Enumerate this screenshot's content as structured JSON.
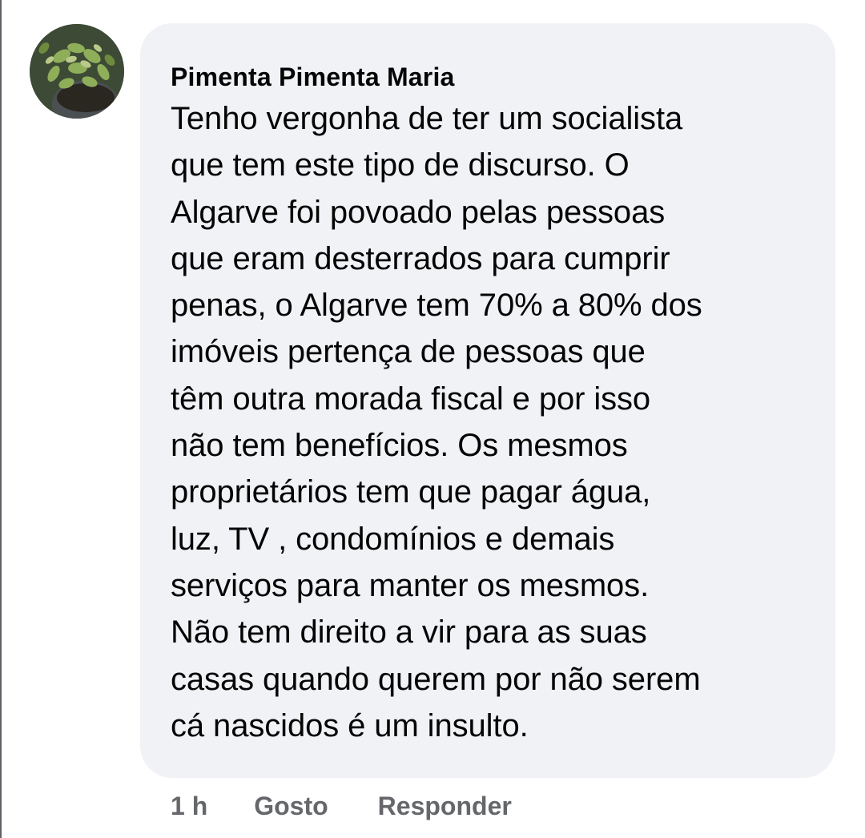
{
  "comment": {
    "author": "Pimenta Pimenta Maria",
    "text_lines": [
      "Tenho vergonha de ter um socialista",
      "que tem este tipo de discurso. O",
      "Algarve foi povoado pelas pessoas",
      "que eram desterrados para cumprir",
      "penas, o Algarve tem 70% a 80% dos",
      "imóveis pertença de pessoas que",
      "têm outra morada fiscal e por isso",
      "não tem benefícios. Os mesmos",
      "proprietários tem que pagar água,",
      "luz, TV , condomínios e demais",
      "serviços para manter os mesmos.",
      "Não tem direito a vir para as suas",
      "casas quando querem por não serem",
      "cá nascidos é um insulto."
    ],
    "time": "1 h",
    "like_label": "Gosto",
    "reply_label": "Responder"
  },
  "colors": {
    "bubble_bg": "#f0f2f5",
    "text": "#050505",
    "secondary_text": "#65676b"
  },
  "icons": {
    "avatar": "profile-photo-succulent-plant"
  }
}
